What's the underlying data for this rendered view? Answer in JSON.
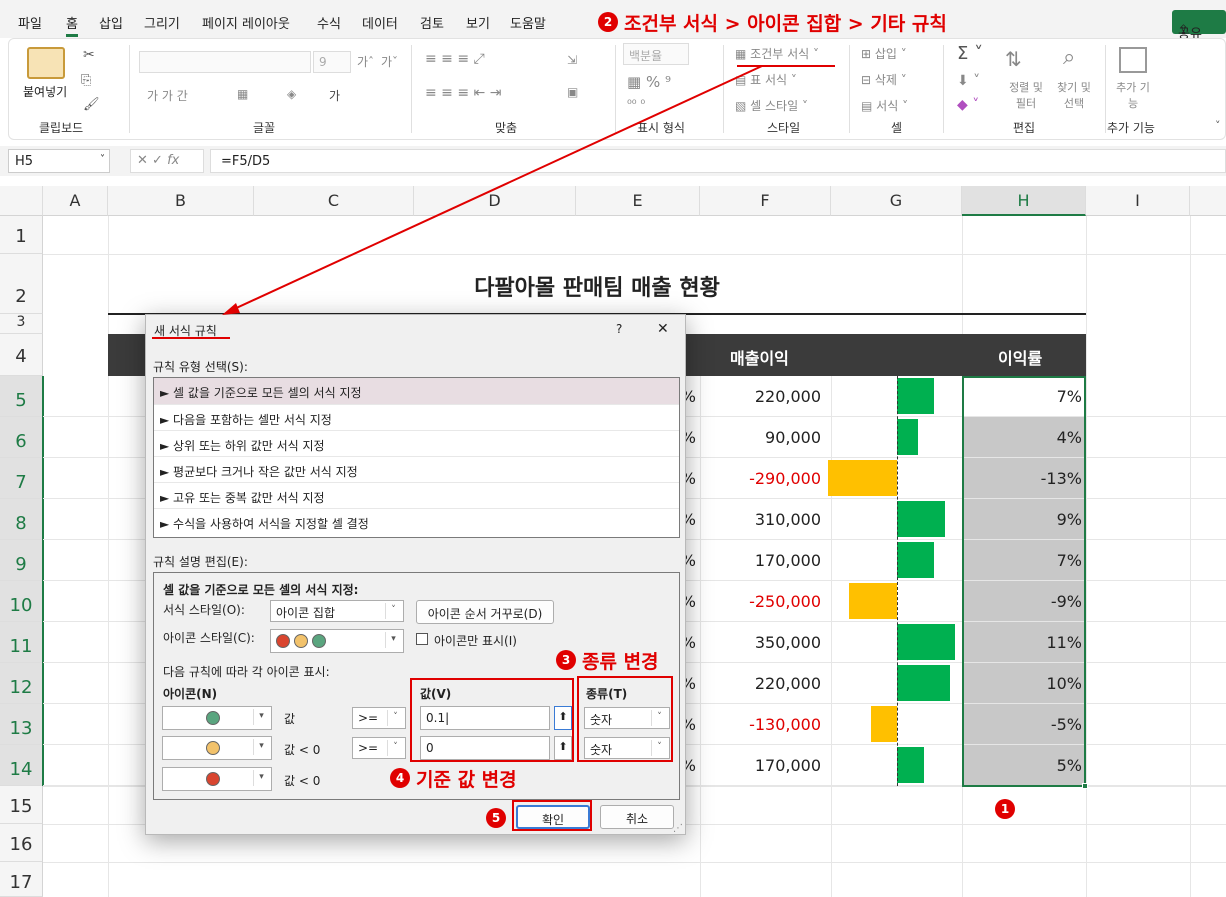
{
  "menu": {
    "items": [
      "파일",
      "홈",
      "삽입",
      "그리기",
      "페이지 레이아웃",
      "수식",
      "데이터",
      "검토",
      "보기",
      "도움말"
    ],
    "share": "공유"
  },
  "ribbon": {
    "paste": "붙여넣기",
    "font_size": "9",
    "number_format": "백분율",
    "cond_format": "조건부 서식",
    "table_format": "표 서식",
    "cell_style": "셀 스타일",
    "insert": "삽입",
    "delete": "삭제",
    "format": "서식",
    "sort_filter": "정렬 및 필터",
    "find_select": "찾기 및 선택",
    "addin": "추가 기능",
    "groups": [
      "클립보드",
      "글꼴",
      "맞춤",
      "표시 형식",
      "스타일",
      "셀",
      "편집",
      "추가 기능"
    ]
  },
  "formula_bar": {
    "name_box": "H5",
    "fx": "fx",
    "formula": "=F5/D5"
  },
  "columns": [
    "A",
    "B",
    "C",
    "D",
    "E",
    "F",
    "G",
    "H",
    "I"
  ],
  "rows": [
    "1",
    "2",
    "3",
    "4",
    "5",
    "6",
    "7",
    "8",
    "9",
    "10",
    "11",
    "12",
    "13",
    "14",
    "15",
    "16",
    "17"
  ],
  "sheet": {
    "title": "다팔아몰 판매팀 매출 현황",
    "header_profit": "매출이익",
    "header_rate": "이익률",
    "pct_sign": "%",
    "profits": [
      "220,000",
      "90,000",
      "-290,000",
      "310,000",
      "170,000",
      "-250,000",
      "350,000",
      "220,000",
      "-130,000",
      "170,000"
    ],
    "rates": [
      "7%",
      "4%",
      "-13%",
      "9%",
      "7%",
      "-9%",
      "11%",
      "10%",
      "-5%",
      "5%"
    ],
    "rate_values": [
      0.07,
      0.04,
      -0.13,
      0.09,
      0.07,
      -0.09,
      0.11,
      0.1,
      -0.05,
      0.05
    ],
    "colors": {
      "positive_bar": "#00b050",
      "negative_bar": "#ffc000",
      "negative_text": "#e00000",
      "header_bg": "#3b3b3b",
      "selected_cell": "#c8c8c8"
    }
  },
  "dialog": {
    "title": "새 서식 규칙",
    "help": "?",
    "close": "✕",
    "rule_type_label": "규칙 유형 선택(S):",
    "rule_types": [
      "► 셀 값을 기준으로 모든 셀의 서식 지정",
      "► 다음을 포함하는 셀만 서식 지정",
      "► 상위 또는 하위 값만 서식 지정",
      "► 평균보다 크거나 작은 값만 서식 지정",
      "► 고유 또는 중복 값만 서식 지정",
      "► 수식을 사용하여 서식을 지정할 셀 결정"
    ],
    "edit_label": "규칙 설명 편집(E):",
    "section_title": "셀 값을 기준으로 모든 셀의 서식 지정:",
    "format_style_label": "서식 스타일(O):",
    "format_style_value": "아이콘 집합",
    "reverse_button": "아이콘 순서 거꾸로(D)",
    "icon_style_label": "아이콘 스타일(C):",
    "icon_only_label": "아이콘만 표시(I)",
    "rule_desc": "다음 규칙에 따라 각 아이콘 표시:",
    "icon_col": "아이콘(N)",
    "value_col": "값(V)",
    "type_col": "종류(T)",
    "rules": [
      {
        "cond": "값",
        "op": ">=",
        "value": "0.1",
        "type": "숫자",
        "icon_color": "#5aa57f"
      },
      {
        "cond": "값 < 0",
        "op": ">=",
        "value": "0",
        "type": "숫자",
        "icon_color": "#f2c26b"
      },
      {
        "cond": "값 < 0",
        "op": "",
        "value": "",
        "type": "",
        "icon_color": "#d9452f"
      }
    ],
    "ok": "확인",
    "cancel": "취소"
  },
  "annotations": {
    "step2": "조건부 서식 > 아이콘 집합 > 기타 규칙",
    "step3": "종류 변경",
    "step4": "기준 값 변경",
    "n1": "1",
    "n2": "2",
    "n3": "3",
    "n4": "4",
    "n5": "5"
  }
}
